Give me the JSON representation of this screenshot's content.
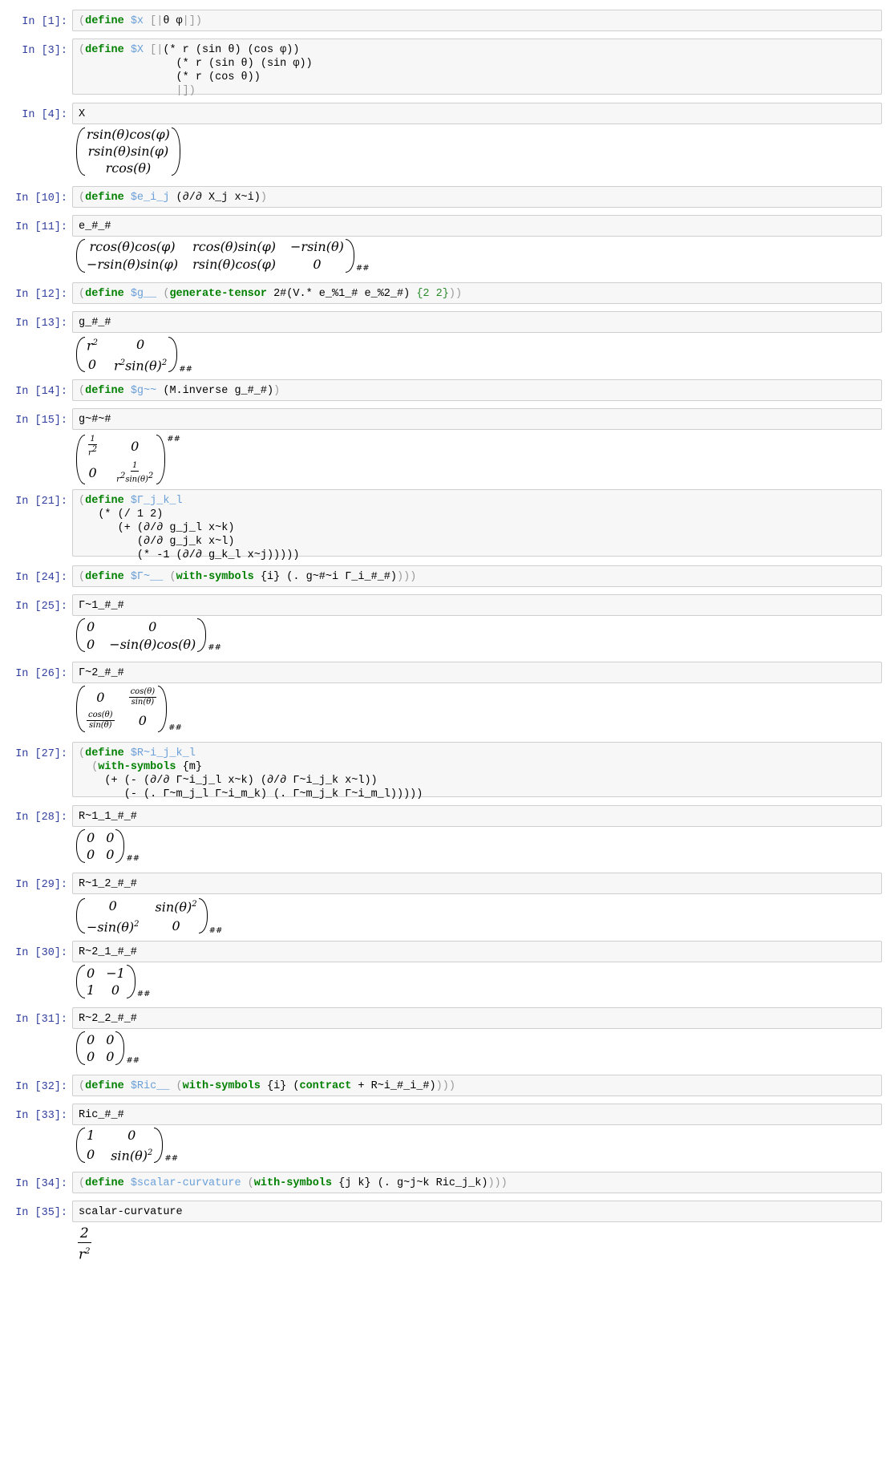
{
  "cells": [
    {
      "prompt": "In [1]:"
    },
    {
      "prompt": "In [3]:"
    },
    {
      "prompt": "In [4]:",
      "code": "X",
      "out": [
        "rsin(θ)cos(φ)",
        "rsin(θ)sin(φ)",
        "rcos(θ)"
      ]
    },
    {
      "prompt": "In [10]:"
    },
    {
      "prompt": "In [11]:",
      "code": "e_#_#",
      "out": [
        "rcos(θ)cos(φ)",
        "rcos(θ)sin(φ)",
        "−rsin(θ)",
        "−rsin(θ)sin(φ)",
        "rsin(θ)cos(φ)",
        "0"
      ],
      "out_sub": "##"
    },
    {
      "prompt": "In [12]:"
    },
    {
      "prompt": "In [13]:",
      "code": "g_#_#",
      "out": [
        "r",
        "0",
        "0",
        "r",
        "sin(θ)"
      ],
      "out_sub": "##"
    },
    {
      "prompt": "In [14]:"
    },
    {
      "prompt": "In [15]:",
      "code": "g~#~#",
      "out": [
        "1",
        "r",
        "0",
        "0",
        "1",
        "r",
        "sin(θ)"
      ],
      "out_sup": "##"
    },
    {
      "prompt": "In [21]:"
    },
    {
      "prompt": "In [24]:"
    },
    {
      "prompt": "In [25]:",
      "code": "Γ~1_#_#",
      "out": [
        "0",
        "0",
        "0",
        "−sin(θ)cos(θ)"
      ],
      "out_sub": "##"
    },
    {
      "prompt": "In [26]:",
      "code": "Γ~2_#_#",
      "out": [
        "0",
        "cos(θ)",
        "sin(θ)",
        "cos(θ)",
        "sin(θ)",
        "0"
      ],
      "out_sub": "##"
    },
    {
      "prompt": "In [27]:"
    },
    {
      "prompt": "In [28]:",
      "code": "R~1_1_#_#",
      "out": [
        "0",
        "0",
        "0",
        "0"
      ],
      "out_sub": "##"
    },
    {
      "prompt": "In [29]:",
      "code": "R~1_2_#_#",
      "out": [
        "0",
        "sin(θ)",
        "−sin(θ)",
        "0"
      ],
      "out_sub": "##"
    },
    {
      "prompt": "In [30]:",
      "code": "R~2_1_#_#",
      "out": [
        "0",
        "−1",
        "1",
        "0"
      ],
      "out_sub": "##"
    },
    {
      "prompt": "In [31]:",
      "code": "R~2_2_#_#",
      "out": [
        "0",
        "0",
        "0",
        "0"
      ],
      "out_sub": "##"
    },
    {
      "prompt": "In [32]:"
    },
    {
      "prompt": "In [33]:",
      "code": "Ric_#_#",
      "out": [
        "1",
        "0",
        "0",
        "sin(θ)"
      ],
      "out_sub": "##"
    },
    {
      "prompt": "In [34]:"
    },
    {
      "prompt": "In [35]:",
      "code": "scalar-curvature",
      "out": [
        "2",
        "r"
      ]
    }
  ],
  "code_tokens": {
    "c1": [
      "(",
      "define",
      "$x",
      "[|",
      "θ φ",
      "|]",
      ")"
    ],
    "c3": [
      "(",
      "define",
      "$X",
      "[|",
      "(* r (sin θ) (cos φ))",
      "(* r (sin θ) (sin φ))",
      "(* r (cos θ))",
      "|]",
      ")"
    ],
    "c10": [
      "(",
      "define",
      "$e_i_j",
      "(∂/∂ X_j x~i)",
      ")"
    ],
    "c12": [
      "(",
      "define",
      "$g__",
      "(",
      "generate-tensor",
      " 2#(V.* e_%1_# e_%2_#) ",
      "{2 2}",
      "))"
    ],
    "c14": [
      "(",
      "define",
      "$g~~",
      "(M.inverse g_#_#)",
      ")"
    ],
    "c21": [
      "(",
      "define",
      "$Γ_j_k_l",
      "(* (/ 1 2)",
      "(+ (∂/∂ g_j_l x~k)",
      "(∂/∂ g_j_k x~l)",
      "(* -1 (∂/∂ g_k_l x~j)))))"
    ],
    "c24": [
      "(",
      "define",
      "$Γ~__",
      "(",
      "with-symbols",
      " {i} (. g~#~i Γ_i_#_#)",
      ")))"
    ],
    "c27": [
      "(",
      "define",
      "$R~i_j_k_l",
      "(",
      "with-symbols",
      " {m}",
      "(+ (- (∂/∂ Γ~i_j_l x~k) (∂/∂ Γ~i_j_k x~l))",
      "(- (. Γ~m_j_l Γ~i_m_k) (. Γ~m_j_k Γ~i_m_l)))))"
    ],
    "c32": [
      "(",
      "define",
      "$Ric__",
      "(",
      "with-symbols",
      " {i} (",
      "contract",
      " + R~i_#_i_#)",
      ")))"
    ],
    "c34": [
      "(",
      "define",
      "$scalar-curvature",
      "(",
      "with-symbols",
      " {j k} (. g~j~k Ric_j_k)",
      ")))"
    ]
  },
  "superscripts": {
    "sq": "2"
  },
  "colors": {
    "prompt": "#303f9f",
    "keyword": "#008000",
    "variable": "#6a9fd8",
    "paren": "#999999"
  }
}
